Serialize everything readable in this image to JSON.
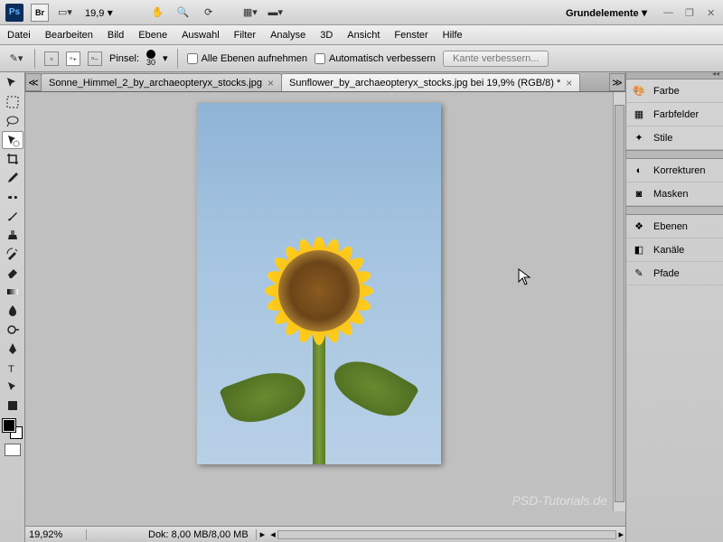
{
  "app": {
    "zoom": "19,9",
    "workspace": "Grundelemente"
  },
  "menu": {
    "datei": "Datei",
    "bearbeiten": "Bearbeiten",
    "bild": "Bild",
    "ebene": "Ebene",
    "auswahl": "Auswahl",
    "filter": "Filter",
    "analyse": "Analyse",
    "dreiD": "3D",
    "ansicht": "Ansicht",
    "fenster": "Fenster",
    "hilfe": "Hilfe"
  },
  "options": {
    "pinsel_label": "Pinsel:",
    "brush_size": "30",
    "chk_all_layers": "Alle Ebenen aufnehmen",
    "chk_auto_enhance": "Automatisch verbessern",
    "refine_edge": "Kante verbessern..."
  },
  "tabs": {
    "tab1": "Sonne_Himmel_2_by_archaeopteryx_stocks.jpg",
    "tab2": "Sunflower_by_archaeopteryx_stocks.jpg bei 19,9% (RGB/8) *"
  },
  "status": {
    "zoom": "19,92%",
    "doc": "Dok: 8,00 MB/8,00 MB"
  },
  "panels": {
    "farbe": "Farbe",
    "farbfelder": "Farbfelder",
    "stile": "Stile",
    "korrekturen": "Korrekturen",
    "masken": "Masken",
    "ebenen": "Ebenen",
    "kanaele": "Kanäle",
    "pfade": "Pfade"
  },
  "watermark": "PSD-Tutorials.de"
}
